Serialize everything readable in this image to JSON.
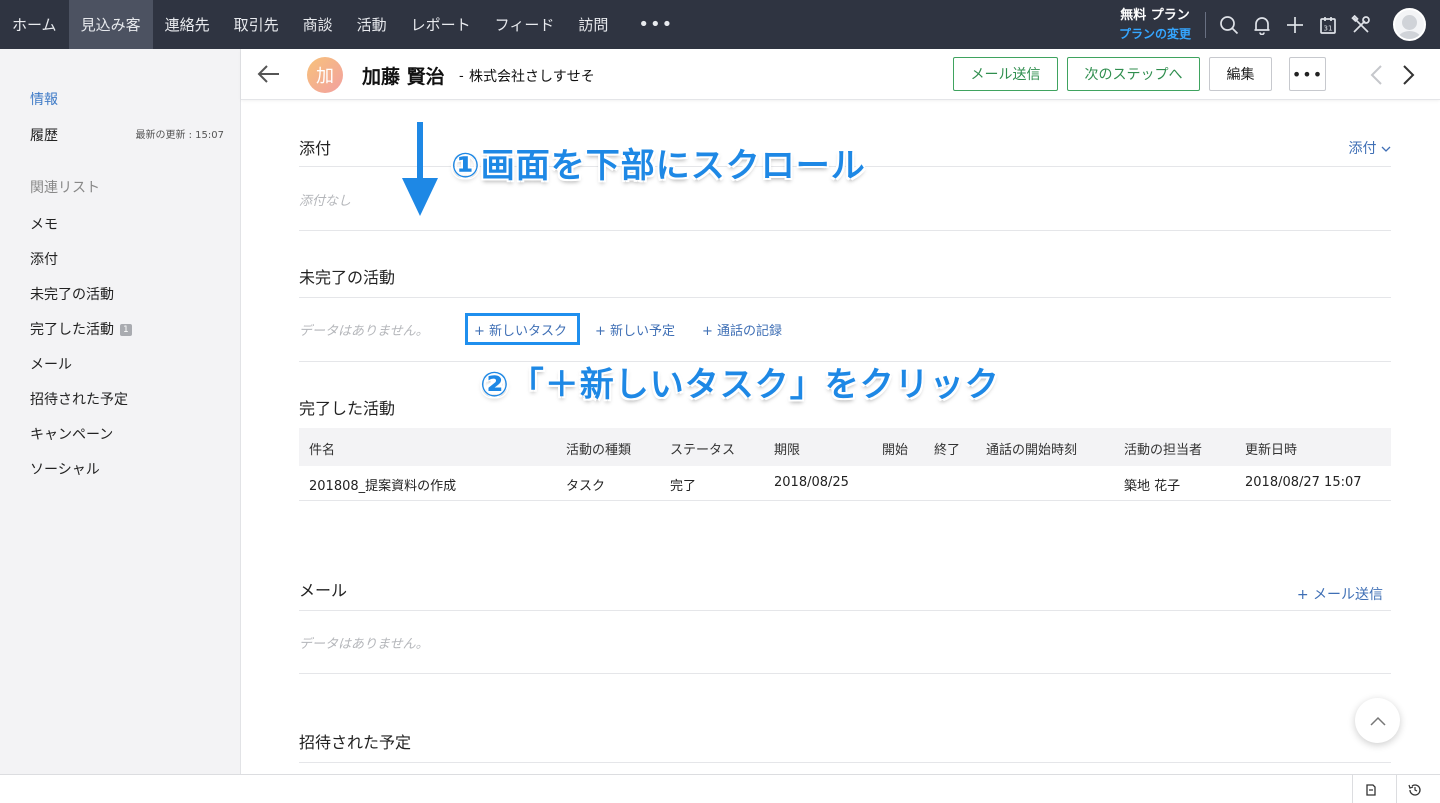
{
  "topnav": {
    "items": [
      "ホーム",
      "見込み客",
      "連絡先",
      "取引先",
      "商談",
      "活動",
      "レポート",
      "フィード",
      "訪問"
    ],
    "active_index": 1,
    "more": "•••",
    "plan_title": "無料 プラン",
    "plan_link": "プランの変更",
    "calendar_day": "31"
  },
  "sidebar": {
    "info": "情報",
    "history": "履歴",
    "updated": "最新の更新 : 15:07",
    "related_list": "関連リスト",
    "items": [
      "メモ",
      "添付",
      "未完了の活動",
      "完了した活動",
      "メール",
      "招待された予定",
      "キャンペーン",
      "ソーシャル"
    ],
    "completed_badge": "1"
  },
  "record": {
    "avatar_char": "加",
    "name": "加藤 賢治",
    "separator": "-",
    "company": "株式会社さしすせそ",
    "buttons": {
      "send_mail": "メール送信",
      "next_step": "次のステップへ",
      "edit": "編集",
      "more": "•••"
    }
  },
  "sections": {
    "attachments": {
      "title": "添付",
      "dropdown": "添付",
      "empty": "添付なし"
    },
    "open_activities": {
      "title": "未完了の活動",
      "empty": "データはありません。",
      "new_task": "新しいタスク",
      "new_event": "新しい予定",
      "log_call": "通話の記録"
    },
    "closed_activities": {
      "title": "完了した活動",
      "columns": [
        "件名",
        "活動の種類",
        "ステータス",
        "期限",
        "開始",
        "終了",
        "通話の開始時刻",
        "活動の担当者",
        "更新日時"
      ],
      "rows": [
        [
          "201808_提案資料の作成",
          "タスク",
          "完了",
          "2018/08/25",
          "",
          "",
          "",
          "築地 花子",
          "2018/08/27 15:07"
        ]
      ]
    },
    "emails": {
      "title": "メール",
      "send": "メール送信",
      "empty": "データはありません。"
    },
    "invited_events": {
      "title": "招待された予定"
    }
  },
  "annotations": {
    "step1": "①画面を下部にスクロール",
    "step2": "②「＋新しいタスク」をクリック"
  },
  "colors": {
    "nav_bg": "#2f3441",
    "accent_blue": "#1e88e5",
    "link": "#3f6fb5",
    "green": "#2f8e4e"
  }
}
